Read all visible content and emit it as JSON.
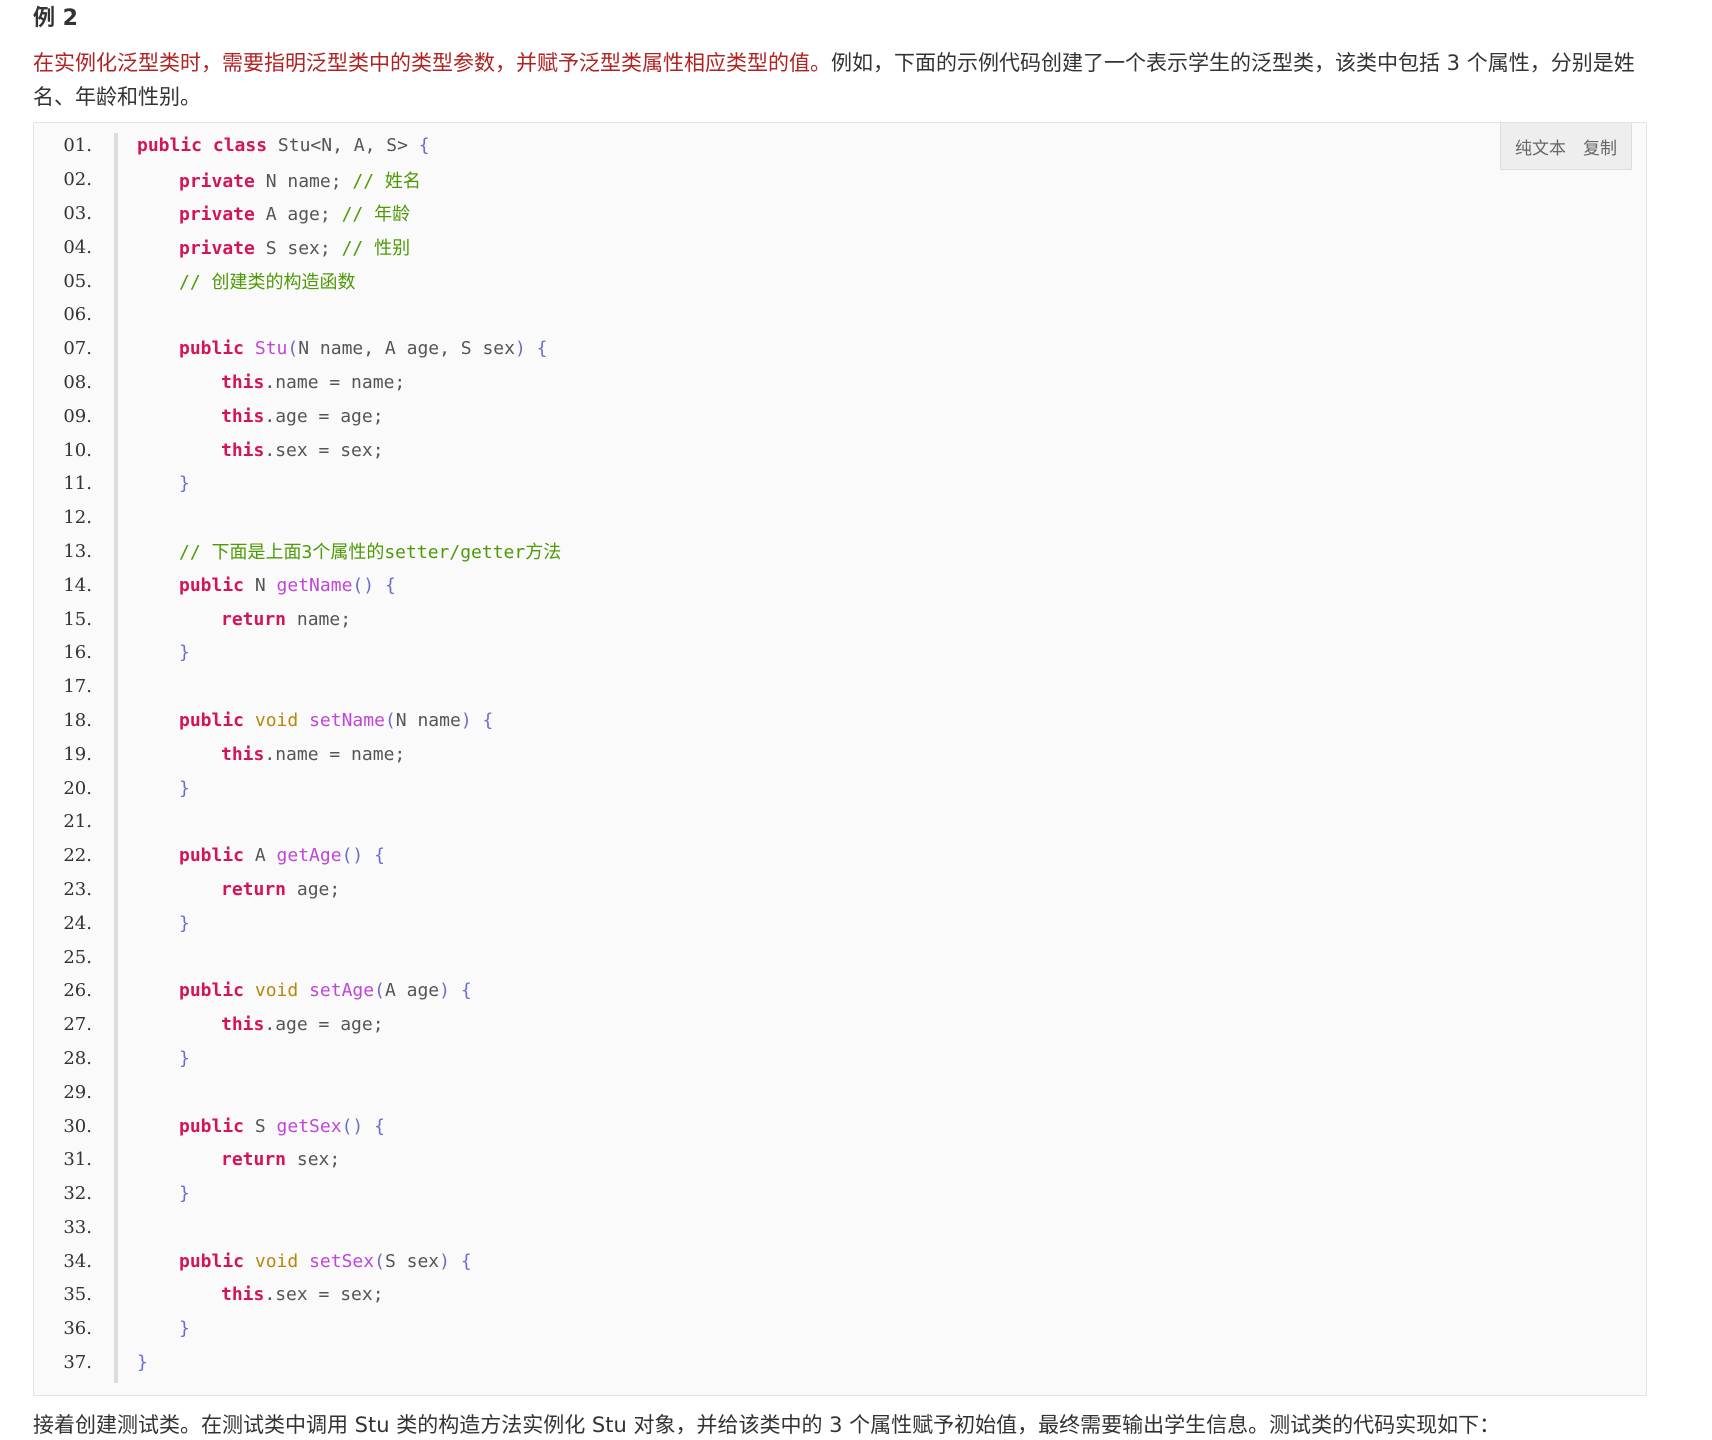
{
  "heading": "例 2",
  "intro": {
    "highlight": "在实例化泛型类时，需要指明泛型类中的类型参数，并赋予泛型类属性相应类型的值。",
    "rest": "例如，下面的示例代码创建了一个表示学生的泛型类，该类中包括 3 个属性，分别是姓名、年龄和性别。"
  },
  "toolbar": {
    "plain_text_label": "纯文本",
    "copy_label": "复制"
  },
  "code_lines": [
    {
      "num": "01.",
      "indent": 0,
      "tokens": [
        [
          "kw",
          "public"
        ],
        [
          "pl",
          " "
        ],
        [
          "kw",
          "class"
        ],
        [
          "pl",
          " Stu<N, A, S> "
        ],
        [
          "br",
          "{"
        ]
      ]
    },
    {
      "num": "02.",
      "indent": 1,
      "tokens": [
        [
          "kw",
          "private"
        ],
        [
          "pl",
          " N name; "
        ],
        [
          "cm",
          "// 姓名"
        ]
      ]
    },
    {
      "num": "03.",
      "indent": 1,
      "tokens": [
        [
          "kw",
          "private"
        ],
        [
          "pl",
          " A age; "
        ],
        [
          "cm",
          "// 年龄"
        ]
      ]
    },
    {
      "num": "04.",
      "indent": 1,
      "tokens": [
        [
          "kw",
          "private"
        ],
        [
          "pl",
          " S sex; "
        ],
        [
          "cm",
          "// 性别"
        ]
      ]
    },
    {
      "num": "05.",
      "indent": 1,
      "tokens": [
        [
          "cm",
          "// 创建类的构造函数"
        ]
      ]
    },
    {
      "num": "06.",
      "indent": 0,
      "tokens": []
    },
    {
      "num": "07.",
      "indent": 1,
      "tokens": [
        [
          "kw",
          "public"
        ],
        [
          "pl",
          " "
        ],
        [
          "fn",
          "Stu"
        ],
        [
          "br",
          "("
        ],
        [
          "pl",
          "N name, A age, S sex"
        ],
        [
          "br",
          ")"
        ],
        [
          "pl",
          " "
        ],
        [
          "br",
          "{"
        ]
      ]
    },
    {
      "num": "08.",
      "indent": 2,
      "tokens": [
        [
          "this",
          "this"
        ],
        [
          "pl",
          ".name = name;"
        ]
      ]
    },
    {
      "num": "09.",
      "indent": 2,
      "tokens": [
        [
          "this",
          "this"
        ],
        [
          "pl",
          ".age = age;"
        ]
      ]
    },
    {
      "num": "10.",
      "indent": 2,
      "tokens": [
        [
          "this",
          "this"
        ],
        [
          "pl",
          ".sex = sex;"
        ]
      ]
    },
    {
      "num": "11.",
      "indent": 1,
      "tokens": [
        [
          "br",
          "}"
        ]
      ]
    },
    {
      "num": "12.",
      "indent": 0,
      "tokens": []
    },
    {
      "num": "13.",
      "indent": 1,
      "tokens": [
        [
          "cm",
          "// 下面是上面3个属性的setter/getter方法"
        ]
      ]
    },
    {
      "num": "14.",
      "indent": 1,
      "tokens": [
        [
          "kw",
          "public"
        ],
        [
          "pl",
          " N "
        ],
        [
          "fn",
          "getName"
        ],
        [
          "br",
          "()"
        ],
        [
          "pl",
          " "
        ],
        [
          "br",
          "{"
        ]
      ]
    },
    {
      "num": "15.",
      "indent": 2,
      "tokens": [
        [
          "kw",
          "return"
        ],
        [
          "pl",
          " name;"
        ]
      ]
    },
    {
      "num": "16.",
      "indent": 1,
      "tokens": [
        [
          "br",
          "}"
        ]
      ]
    },
    {
      "num": "17.",
      "indent": 0,
      "tokens": []
    },
    {
      "num": "18.",
      "indent": 1,
      "tokens": [
        [
          "kw",
          "public"
        ],
        [
          "pl",
          " "
        ],
        [
          "type",
          "void"
        ],
        [
          "pl",
          " "
        ],
        [
          "fn",
          "setName"
        ],
        [
          "br",
          "("
        ],
        [
          "pl",
          "N name"
        ],
        [
          "br",
          ")"
        ],
        [
          "pl",
          " "
        ],
        [
          "br",
          "{"
        ]
      ]
    },
    {
      "num": "19.",
      "indent": 2,
      "tokens": [
        [
          "this",
          "this"
        ],
        [
          "pl",
          ".name = name;"
        ]
      ]
    },
    {
      "num": "20.",
      "indent": 1,
      "tokens": [
        [
          "br",
          "}"
        ]
      ]
    },
    {
      "num": "21.",
      "indent": 0,
      "tokens": []
    },
    {
      "num": "22.",
      "indent": 1,
      "tokens": [
        [
          "kw",
          "public"
        ],
        [
          "pl",
          " A "
        ],
        [
          "fn",
          "getAge"
        ],
        [
          "br",
          "()"
        ],
        [
          "pl",
          " "
        ],
        [
          "br",
          "{"
        ]
      ]
    },
    {
      "num": "23.",
      "indent": 2,
      "tokens": [
        [
          "kw",
          "return"
        ],
        [
          "pl",
          " age;"
        ]
      ]
    },
    {
      "num": "24.",
      "indent": 1,
      "tokens": [
        [
          "br",
          "}"
        ]
      ]
    },
    {
      "num": "25.",
      "indent": 0,
      "tokens": []
    },
    {
      "num": "26.",
      "indent": 1,
      "tokens": [
        [
          "kw",
          "public"
        ],
        [
          "pl",
          " "
        ],
        [
          "type",
          "void"
        ],
        [
          "pl",
          " "
        ],
        [
          "fn",
          "setAge"
        ],
        [
          "br",
          "("
        ],
        [
          "pl",
          "A age"
        ],
        [
          "br",
          ")"
        ],
        [
          "pl",
          " "
        ],
        [
          "br",
          "{"
        ]
      ]
    },
    {
      "num": "27.",
      "indent": 2,
      "tokens": [
        [
          "this",
          "this"
        ],
        [
          "pl",
          ".age = age;"
        ]
      ]
    },
    {
      "num": "28.",
      "indent": 1,
      "tokens": [
        [
          "br",
          "}"
        ]
      ]
    },
    {
      "num": "29.",
      "indent": 0,
      "tokens": []
    },
    {
      "num": "30.",
      "indent": 1,
      "tokens": [
        [
          "kw",
          "public"
        ],
        [
          "pl",
          " S "
        ],
        [
          "fn",
          "getSex"
        ],
        [
          "br",
          "()"
        ],
        [
          "pl",
          " "
        ],
        [
          "br",
          "{"
        ]
      ]
    },
    {
      "num": "31.",
      "indent": 2,
      "tokens": [
        [
          "kw",
          "return"
        ],
        [
          "pl",
          " sex;"
        ]
      ]
    },
    {
      "num": "32.",
      "indent": 1,
      "tokens": [
        [
          "br",
          "}"
        ]
      ]
    },
    {
      "num": "33.",
      "indent": 0,
      "tokens": []
    },
    {
      "num": "34.",
      "indent": 1,
      "tokens": [
        [
          "kw",
          "public"
        ],
        [
          "pl",
          " "
        ],
        [
          "type",
          "void"
        ],
        [
          "pl",
          " "
        ],
        [
          "fn",
          "setSex"
        ],
        [
          "br",
          "("
        ],
        [
          "pl",
          "S sex"
        ],
        [
          "br",
          ")"
        ],
        [
          "pl",
          " "
        ],
        [
          "br",
          "{"
        ]
      ]
    },
    {
      "num": "35.",
      "indent": 2,
      "tokens": [
        [
          "this",
          "this"
        ],
        [
          "pl",
          ".sex = sex;"
        ]
      ]
    },
    {
      "num": "36.",
      "indent": 1,
      "tokens": [
        [
          "br",
          "}"
        ]
      ]
    },
    {
      "num": "37.",
      "indent": 0,
      "tokens": [
        [
          "br",
          "}"
        ]
      ]
    }
  ],
  "outro": "接着创建测试类。在测试类中调用 Stu 类的构造方法实例化 Stu 对象，并给该类中的 3 个属性赋予初始值，最终需要输出学生信息。测试类的代码实现如下："
}
